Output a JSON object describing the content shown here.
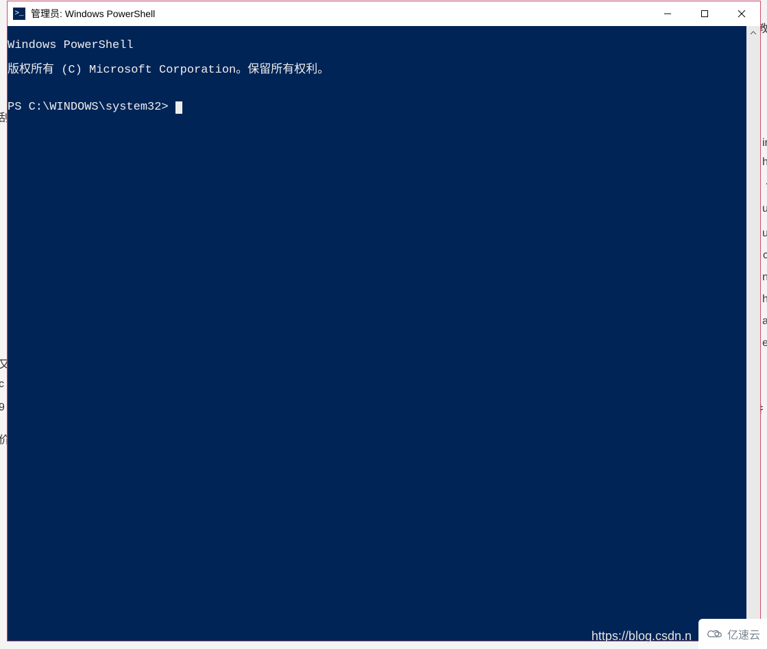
{
  "window": {
    "icon_glyph": ">_",
    "title": "管理员: Windows PowerShell"
  },
  "console": {
    "lines": [
      "Windows PowerShell",
      "版权所有 (C) Microsoft Corporation。保留所有权利。",
      "",
      "PS C:\\WINDOWS\\system32> "
    ]
  },
  "background_fragments": {
    "left1": "刮",
    "left2": "又",
    "left3": "c",
    "left4": "9",
    "left5": "价",
    "right0": "教",
    "right1": "ir",
    "right2": "h",
    "right3": ".",
    "right4": "u",
    "right5": "u",
    "right6": "c",
    "right7": "n",
    "right8": "h",
    "right9": "a",
    "right10": "e",
    "right11": "扌"
  },
  "watermark": {
    "url": "https://blog.csdn.n",
    "logo_text": "亿速云"
  }
}
